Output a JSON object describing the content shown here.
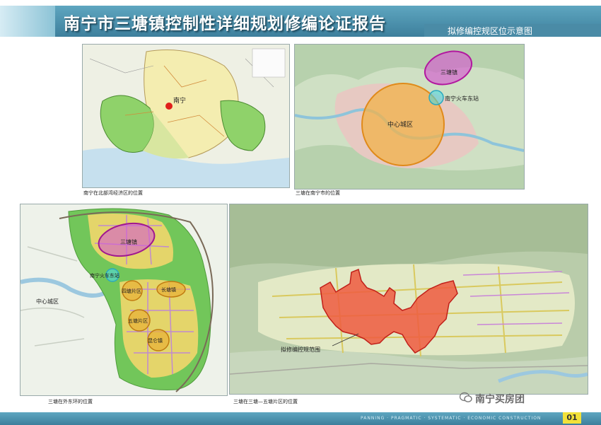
{
  "header": {
    "title": "南宁市三塘镇控制性详细规划修编论证报告",
    "subtitle": "拟修编控规区位示意图"
  },
  "maps": [
    {
      "caption": "南宁在北部湾经济区的位置",
      "labels": {
        "city": "南宁"
      }
    },
    {
      "caption": "三塘在南宁市的位置",
      "labels": {
        "town": "三塘镇",
        "station": "南宁火车东站",
        "center": "中心城区"
      }
    },
    {
      "caption": "三塘在外东环的位置",
      "labels": {
        "town": "三塘镇",
        "station": "南宁火车东站",
        "center": "中心城区",
        "area_a": "四塘片区",
        "area_b": "长塘镇",
        "area_c": "五塘片区",
        "area_d": "昆仑镇"
      }
    },
    {
      "caption": "三塘在三塘—五塘片区的位置",
      "labels": {
        "study_area": "拟修编控规范围"
      }
    }
  ],
  "footer": {
    "text": "PANNING · PRAGMATIC · SYSTEMATIC · ECONOMIC CONSTRUCTION",
    "page": "01",
    "watermark": "南宁买房团"
  }
}
